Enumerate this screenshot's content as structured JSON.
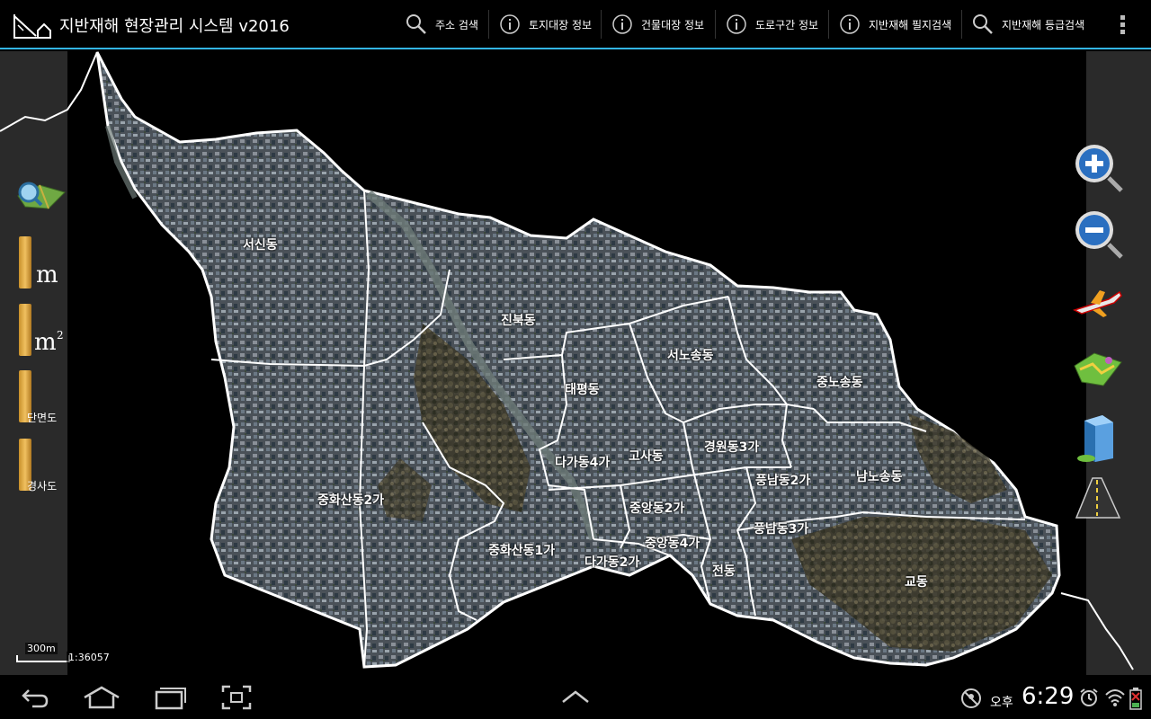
{
  "app": {
    "title": "지반재해 현장관리 시스템 v2016"
  },
  "toolbar": {
    "items": [
      {
        "label": "주소 검색",
        "icon": "search-icon"
      },
      {
        "label": "토지대장 정보",
        "icon": "info-icon"
      },
      {
        "label": "건물대장 정보",
        "icon": "info-icon"
      },
      {
        "label": "도로구간 정보",
        "icon": "info-icon"
      },
      {
        "label": "지반재해 필지검색",
        "icon": "info-icon"
      },
      {
        "label": "지반재해 등급검색",
        "icon": "search-icon"
      }
    ]
  },
  "left_tools": {
    "length_unit": "m",
    "area_unit": "m",
    "area_sup": "2",
    "section_label": "단면도",
    "slope_label": "경사도"
  },
  "map": {
    "districts": [
      "서신동",
      "진북동",
      "태평동",
      "서노송동",
      "중노송동",
      "경원동3가",
      "다가동4가",
      "고사동",
      "풍남동2가",
      "남노송동",
      "중화산동2가",
      "중앙동2가",
      "중앙동4가",
      "풍남동3가",
      "중화산동1가",
      "다가동2가",
      "전동",
      "교동"
    ]
  },
  "scale": {
    "distance": "300m",
    "ratio": "1:36057"
  },
  "status": {
    "ampm": "오후",
    "time": "6:29"
  },
  "colors": {
    "accent": "#33b5e5",
    "panel": "#2a2a2a",
    "boundary": "#ffffff"
  }
}
